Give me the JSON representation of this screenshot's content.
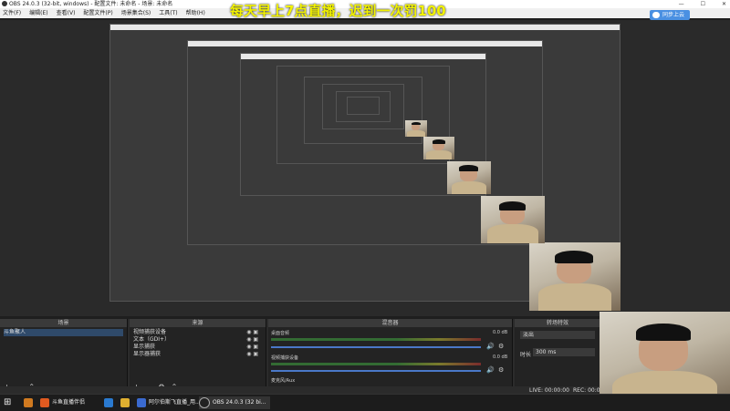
{
  "window": {
    "title": "OBS 24.0.3 (32-bit, windows) - 配置文件: 未命名 - 场景: 未命名",
    "controls": [
      "—",
      "☐",
      "✕"
    ]
  },
  "menu": [
    "文件(F)",
    "编辑(E)",
    "查看(V)",
    "配置文件(P)",
    "场景集合(S)",
    "工具(T)",
    "帮助(H)"
  ],
  "overlay_text": "每天早上7点直播，迟到一次罚100",
  "cloud_button": "同步上云",
  "panels": {
    "scenes": {
      "title": "场景",
      "items": [
        "斗鱼聚人"
      ]
    },
    "sources": {
      "title": "来源",
      "items": [
        "视频捕获设备",
        "文本（GDI+）",
        "显示捕获",
        "显示器捕获"
      ]
    },
    "mixer": {
      "title": "混音器",
      "channels": [
        {
          "label": "桌面音频",
          "db": "0.0 dB"
        },
        {
          "label": "视频捕获设备",
          "db": "0.0 dB"
        },
        {
          "label": "麦克风/Aux",
          "db": ""
        }
      ]
    },
    "transitions": {
      "title": "转场特效",
      "mode": "淡出",
      "duration_label": "时长",
      "duration_value": "300 ms"
    }
  },
  "status": {
    "live": "LIVE: 00:00:00",
    "rec": "REC: 00:00:00"
  },
  "taskbar": {
    "items": [
      {
        "label": "斗鱼直播伴侣"
      },
      {
        "label": "阿尔伯斯飞直播_用..."
      },
      {
        "label": "OBS 24.0.3 (32 bi..."
      }
    ]
  },
  "colors": {
    "overlay": "#f2f200",
    "accent": "#4a90e2"
  }
}
